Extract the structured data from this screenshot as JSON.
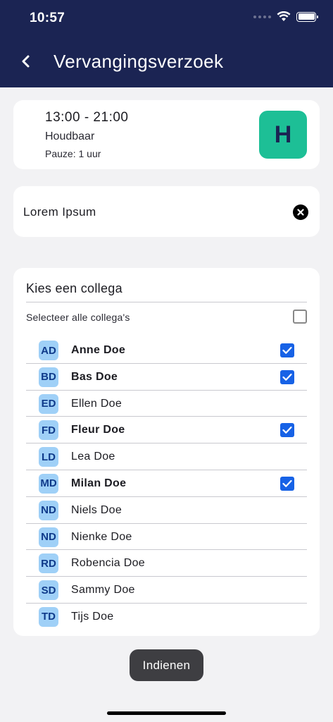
{
  "status_bar": {
    "time": "10:57"
  },
  "header": {
    "title": "Vervangingsverzoek"
  },
  "shift": {
    "time": "13:00 - 21:00",
    "name": "Houdbaar",
    "pause": "Pauze: 1 uur",
    "badge": "H",
    "badge_color": "#1dbf96"
  },
  "reason": {
    "value": "Lorem Ipsum"
  },
  "colleagues": {
    "title": "Kies een collega",
    "select_all_label": "Selecteer alle collega's",
    "select_all_checked": false,
    "items": [
      {
        "initials": "AD",
        "name": "Anne Doe",
        "selected": true
      },
      {
        "initials": "BD",
        "name": "Bas Doe",
        "selected": true
      },
      {
        "initials": "ED",
        "name": "Ellen Doe",
        "selected": false
      },
      {
        "initials": "FD",
        "name": "Fleur Doe",
        "selected": true
      },
      {
        "initials": "LD",
        "name": "Lea Doe",
        "selected": false
      },
      {
        "initials": "MD",
        "name": "Milan Doe",
        "selected": true
      },
      {
        "initials": "ND",
        "name": "Niels Doe",
        "selected": false
      },
      {
        "initials": "ND",
        "name": "Nienke Doe",
        "selected": false
      },
      {
        "initials": "RD",
        "name": "Robencia Doe",
        "selected": false
      },
      {
        "initials": "SD",
        "name": "Sammy Doe",
        "selected": false
      },
      {
        "initials": "TD",
        "name": "Tijs Doe",
        "selected": false
      }
    ]
  },
  "submit": {
    "label": "Indienen"
  },
  "colors": {
    "header_bg": "#1b2453",
    "check": "#1762e6",
    "avatar_bg": "#9fd0f7",
    "button_bg": "#3e3e42"
  },
  "icons": {
    "back": "chevron-left-icon",
    "clear": "close-circle-icon",
    "check": "checkmark-icon",
    "wifi": "wifi-icon",
    "battery": "battery-icon",
    "signal": "signal-icon"
  }
}
